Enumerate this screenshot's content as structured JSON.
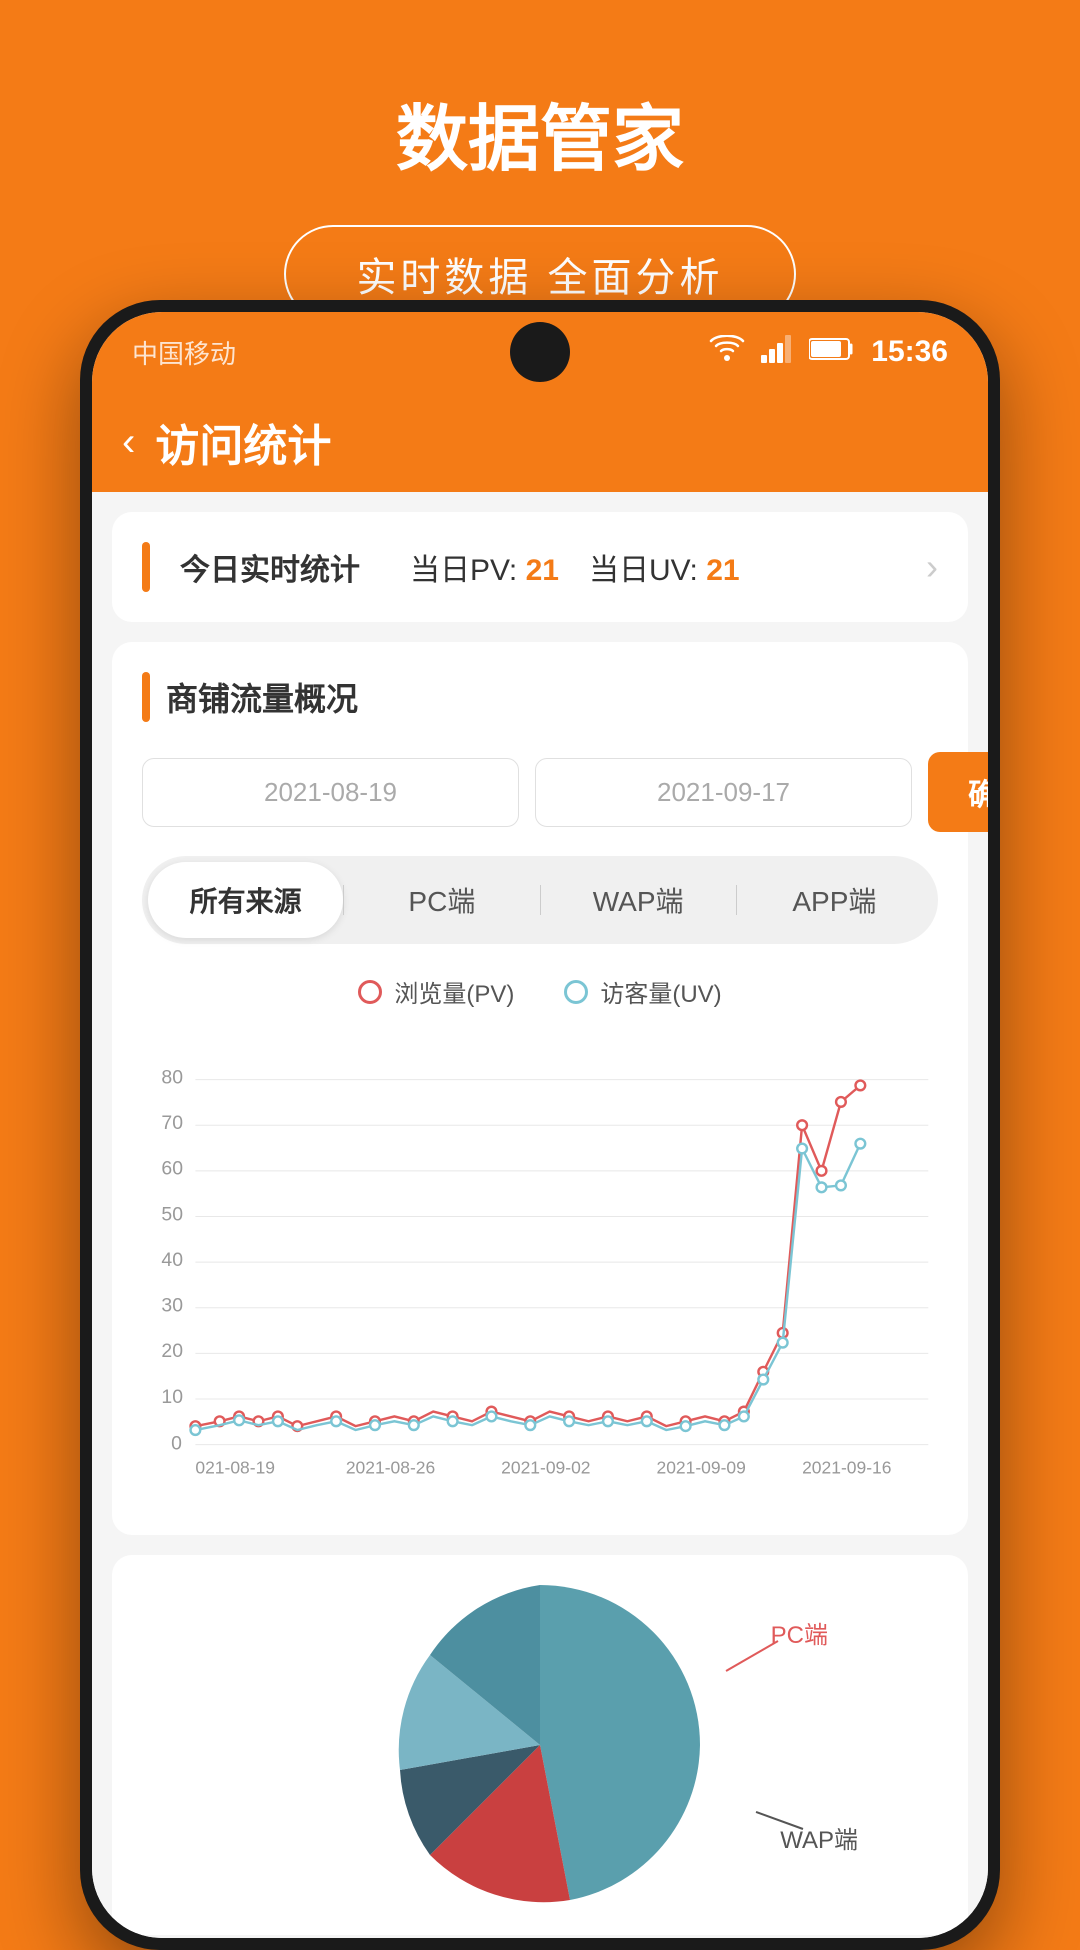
{
  "app": {
    "title": "数据管家",
    "tagline": "实时数据 全面分析"
  },
  "status_bar": {
    "carrier": "中国移动",
    "time": "15:36"
  },
  "header": {
    "title": "访问统计",
    "back_label": "‹"
  },
  "today_stats": {
    "label": "今日实时统计",
    "pv_label": "当日PV:",
    "pv_value": "21",
    "uv_label": "当日UV:",
    "uv_value": "21"
  },
  "traffic": {
    "section_title": "商铺流量概况",
    "date_start": "2021-08-19",
    "date_end": "2021-09-17",
    "confirm_label": "确定",
    "tabs": [
      {
        "label": "所有来源",
        "active": true
      },
      {
        "label": "PC端",
        "active": false
      },
      {
        "label": "WAP端",
        "active": false
      },
      {
        "label": "APP端",
        "active": false
      }
    ]
  },
  "chart": {
    "legend_pv": "浏览量(PV)",
    "legend_uv": "访客量(UV)",
    "y_labels": [
      "0",
      "10",
      "20",
      "30",
      "40",
      "50",
      "60",
      "70",
      "80"
    ],
    "x_labels": [
      "021-08-19",
      "2021-08-26",
      "2021-09-02",
      "2021-09-09",
      "2021-09-16"
    ]
  },
  "pie": {
    "label_pc": "PC端",
    "label_wap": "WAP端"
  }
}
